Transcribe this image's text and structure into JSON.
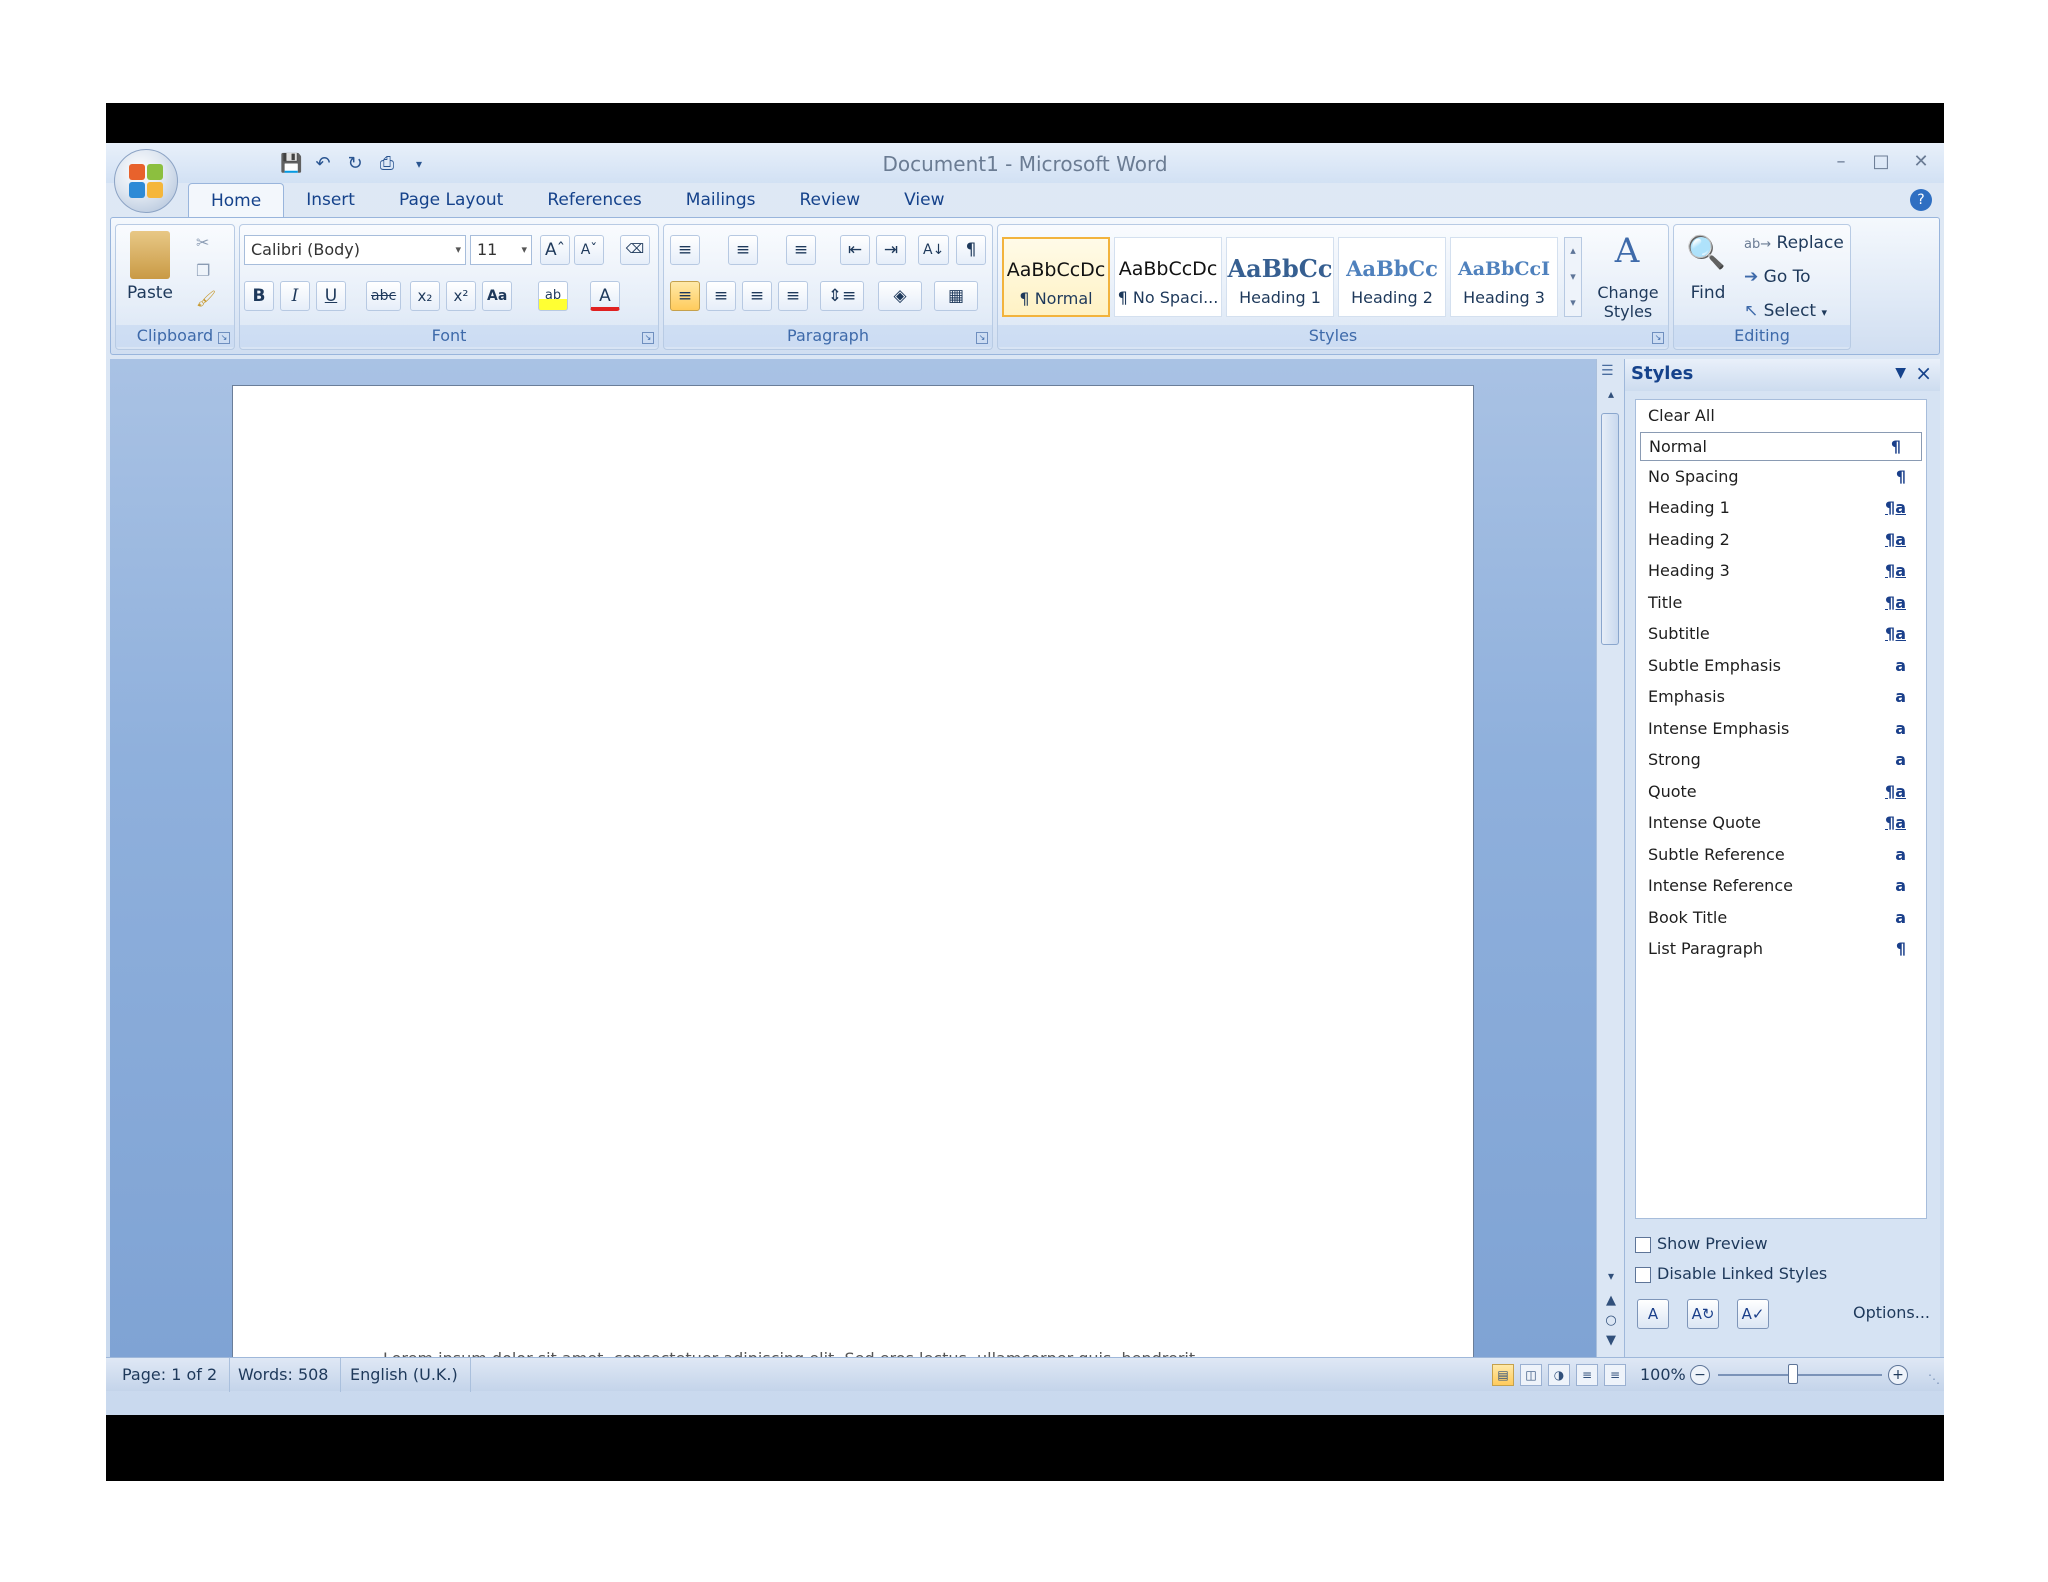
{
  "window": {
    "title": "Document1 - Microsoft Word"
  },
  "tabs": [
    "Home",
    "Insert",
    "Page Layout",
    "References",
    "Mailings",
    "Review",
    "View"
  ],
  "ribbon": {
    "clipboard": {
      "label": "Clipboard",
      "paste": "Paste"
    },
    "font": {
      "label": "Font",
      "font_name": "Calibri (Body)",
      "font_size": "11"
    },
    "paragraph": {
      "label": "Paragraph"
    },
    "styles": {
      "label": "Styles",
      "quick": [
        {
          "sample": "AaBbCcDc",
          "name": "¶ Normal"
        },
        {
          "sample": "AaBbCcDc",
          "name": "¶ No Spaci..."
        },
        {
          "sample": "AaBbCc",
          "name": "Heading 1"
        },
        {
          "sample": "AaBbCc",
          "name": "Heading 2"
        },
        {
          "sample": "AaBbCcI",
          "name": "Heading 3"
        }
      ],
      "change_styles": "Change Styles"
    },
    "editing": {
      "label": "Editing",
      "find": "Find",
      "replace": "Replace",
      "goto": "Go To",
      "select": "Select"
    }
  },
  "document": {
    "peek_text": "Lorem ipsum dolor sit amet, consectetuer adipiscing elit. Sed eros lectus, ullamcorper quis, hendrerit"
  },
  "styles_pane": {
    "title": "Styles",
    "items": [
      {
        "name": "Clear All",
        "sym": ""
      },
      {
        "name": "Normal",
        "sym": "¶"
      },
      {
        "name": "No Spacing",
        "sym": "¶"
      },
      {
        "name": "Heading 1",
        "sym": "¶a"
      },
      {
        "name": "Heading 2",
        "sym": "¶a"
      },
      {
        "name": "Heading 3",
        "sym": "¶a"
      },
      {
        "name": "Title",
        "sym": "¶a"
      },
      {
        "name": "Subtitle",
        "sym": "¶a"
      },
      {
        "name": "Subtle Emphasis",
        "sym": "a"
      },
      {
        "name": "Emphasis",
        "sym": "a"
      },
      {
        "name": "Intense Emphasis",
        "sym": "a"
      },
      {
        "name": "Strong",
        "sym": "a"
      },
      {
        "name": "Quote",
        "sym": "¶a"
      },
      {
        "name": "Intense Quote",
        "sym": "¶a"
      },
      {
        "name": "Subtle Reference",
        "sym": "a"
      },
      {
        "name": "Intense Reference",
        "sym": "a"
      },
      {
        "name": "Book Title",
        "sym": "a"
      },
      {
        "name": "List Paragraph",
        "sym": "¶"
      }
    ],
    "selected_index": 1,
    "show_preview": "Show Preview",
    "disable_linked": "Disable Linked Styles",
    "options": "Options..."
  },
  "status": {
    "page": "Page: 1 of 2",
    "words": "Words: 508",
    "language": "English (U.K.)",
    "zoom": "100%"
  }
}
